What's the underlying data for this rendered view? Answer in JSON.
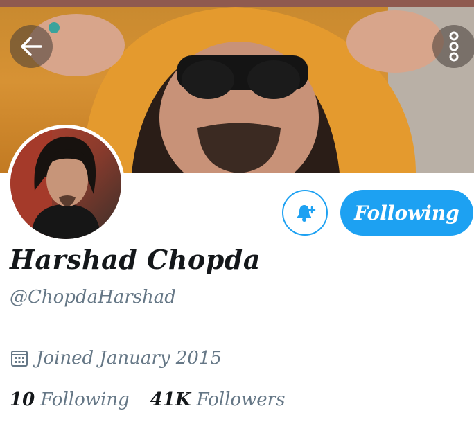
{
  "profile": {
    "name": "Harshad Chopda",
    "handle": "@ChopdaHarshad",
    "joined": "Joined January 2015",
    "following_count": "10",
    "following_label": "Following",
    "followers_count": "41K",
    "followers_label": "Followers"
  },
  "actions": {
    "follow_label": "Following"
  },
  "icons": {
    "back": "arrow-left-icon",
    "more": "more-vertical-icon",
    "notify": "bell-plus-icon",
    "calendar": "calendar-icon"
  },
  "colors": {
    "accent": "#1da1f2",
    "text_primary": "#14171a",
    "text_secondary": "#657786"
  }
}
